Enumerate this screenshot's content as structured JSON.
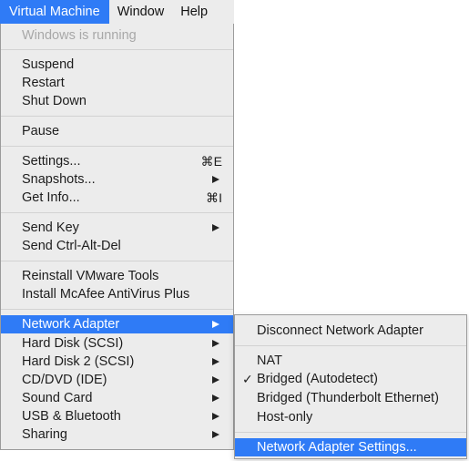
{
  "menubar": {
    "items": [
      "Virtual Machine",
      "Window",
      "Help"
    ]
  },
  "menu": {
    "status": "Windows is running",
    "suspend": "Suspend",
    "restart": "Restart",
    "shut_down": "Shut Down",
    "pause": "Pause",
    "settings": "Settings...",
    "settings_shortcut": "⌘E",
    "snapshots": "Snapshots...",
    "get_info": "Get Info...",
    "get_info_shortcut": "⌘I",
    "send_key": "Send Key",
    "send_ctrl_alt_del": "Send Ctrl-Alt-Del",
    "reinstall_tools": "Reinstall VMware Tools",
    "install_mcafee": "Install McAfee AntiVirus Plus",
    "network_adapter": "Network Adapter",
    "hard_disk": "Hard Disk (SCSI)",
    "hard_disk_2": "Hard Disk 2 (SCSI)",
    "cd_dvd": "CD/DVD (IDE)",
    "sound_card": "Sound Card",
    "usb_bluetooth": "USB & Bluetooth",
    "sharing": "Sharing"
  },
  "submenu": {
    "disconnect": "Disconnect Network Adapter",
    "nat": "NAT",
    "bridged_auto": "Bridged (Autodetect)",
    "bridged_tb": "Bridged (Thunderbolt Ethernet)",
    "host_only": "Host-only",
    "settings": "Network Adapter Settings...",
    "checkmark": "✓"
  },
  "colors": {
    "highlight": "#2f7bf6",
    "menu_bg": "#ececec",
    "disabled_text": "#a8a8a8"
  }
}
